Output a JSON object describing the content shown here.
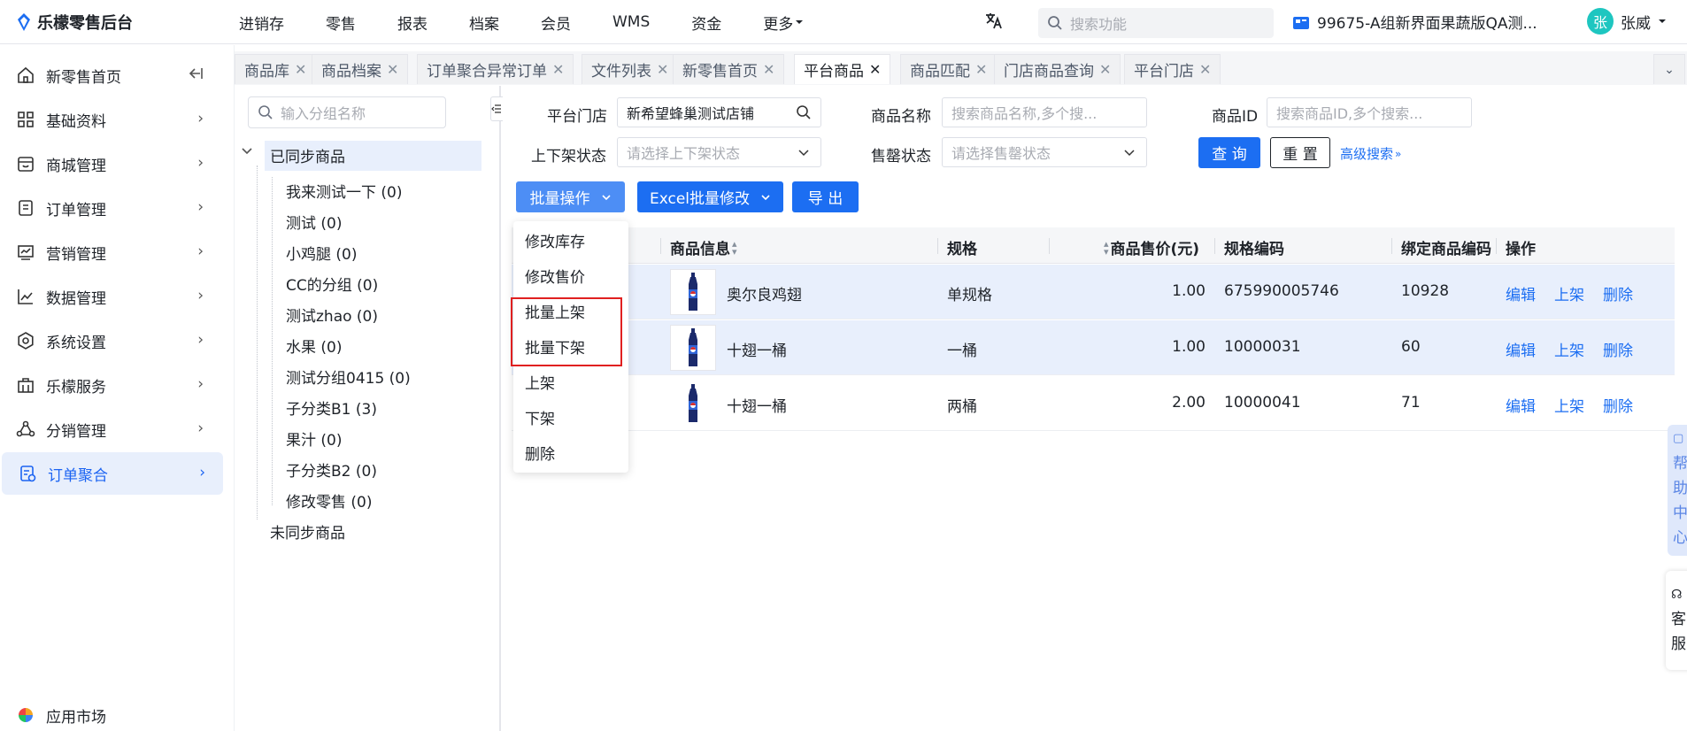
{
  "header": {
    "app_title": "乐檬零售后台",
    "nav": [
      "进销存",
      "零售",
      "报表",
      "档案",
      "会员",
      "WMS",
      "资金"
    ],
    "more_label": "更多",
    "search_placeholder": "搜索功能",
    "store_name": "99675-A组新界面果蔬版QA测...",
    "user_avatar": "张",
    "user_name": "张威"
  },
  "sidebar": {
    "items": [
      {
        "label": "新零售首页",
        "icon": "home-icon"
      },
      {
        "label": "基础资料",
        "icon": "grid-icon"
      },
      {
        "label": "商城管理",
        "icon": "store-icon"
      },
      {
        "label": "订单管理",
        "icon": "document-icon"
      },
      {
        "label": "营销管理",
        "icon": "chart-screen-icon"
      },
      {
        "label": "数据管理",
        "icon": "line-chart-icon"
      },
      {
        "label": "系统设置",
        "icon": "settings-icon"
      },
      {
        "label": "乐檬服务",
        "icon": "briefcase-icon"
      },
      {
        "label": "分销管理",
        "icon": "distribution-icon"
      },
      {
        "label": "订单聚合",
        "icon": "order-aggregate-icon"
      }
    ],
    "bottom_label": "应用市场"
  },
  "tabs": [
    {
      "label": "商品库"
    },
    {
      "label": "商品档案"
    },
    {
      "label": "订单聚合异常订单"
    },
    {
      "label": "文件列表"
    },
    {
      "label": "新零售首页"
    },
    {
      "label": "平台商品"
    },
    {
      "label": "商品匹配"
    },
    {
      "label": "门店商品查询"
    },
    {
      "label": "平台门店"
    }
  ],
  "group_panel": {
    "search_placeholder": "输入分组名称",
    "synced_label": "已同步商品",
    "children": [
      "我来测试一下 (0)",
      "测试 (0)",
      "小鸡腿 (0)",
      "CC的分组 (0)",
      "测试zhao (0)",
      "水果 (0)",
      "测试分组0415 (0)",
      "子分类B1 (3)",
      "果汁 (0)",
      "子分类B2 (0)",
      "修改零售 (0)"
    ],
    "unsynced_label": "未同步商品"
  },
  "filters": {
    "platform_store_label": "平台门店",
    "platform_store_value": "新希望蜂巢测试店铺",
    "product_name_label": "商品名称",
    "product_name_placeholder": "搜索商品名称,多个搜...",
    "product_id_label": "商品ID",
    "product_id_placeholder": "搜索商品ID,多个搜索...",
    "shelf_status_label": "上下架状态",
    "shelf_status_placeholder": "请选择上下架状态",
    "soldout_label": "售罄状态",
    "soldout_placeholder": "请选择售罄状态",
    "query_label": "查 询",
    "reset_label": "重 置",
    "advanced_label": "高级搜索"
  },
  "actions": {
    "batch_label": "批量操作",
    "excel_label": "Excel批量修改",
    "export_label": "导 出"
  },
  "dropdown": {
    "items": [
      "修改库存",
      "修改售价",
      "批量上架",
      "批量下架",
      "上架",
      "下架",
      "删除"
    ]
  },
  "table": {
    "columns": [
      "商品信息",
      "规格",
      "商品售价(元)",
      "规格编码",
      "绑定商品编码",
      "操作"
    ],
    "row_actions": [
      "编辑",
      "上架",
      "删除"
    ],
    "rows": [
      {
        "name": "奥尔良鸡翅",
        "spec": "单规格",
        "price": "1.00",
        "spec_code": "675990005746",
        "bind_code": "10928"
      },
      {
        "name": "十翅一桶",
        "spec": "一桶",
        "price": "1.00",
        "spec_code": "10000031",
        "bind_code": "60"
      },
      {
        "name": "十翅一桶",
        "spec": "两桶",
        "price": "2.00",
        "spec_code": "10000041",
        "bind_code": "71"
      }
    ]
  },
  "floats": {
    "help": "帮助中心",
    "service": "客服"
  },
  "colors": {
    "primary": "#1c6ef2",
    "selected_row": "#e8effc",
    "highlight_box": "#e02020"
  }
}
